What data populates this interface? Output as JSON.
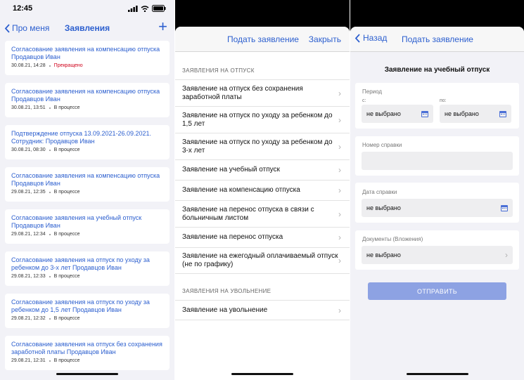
{
  "panel1": {
    "status_time": "12:45",
    "back_label": "Про меня",
    "title": "Заявления",
    "add_label": "+",
    "items": [
      {
        "title": "Согласование заявления на компенсацию отпуска Продавцов Иван",
        "date": "30.08.21, 14:28",
        "status": "Прекращено",
        "red": true
      },
      {
        "title": "Согласование заявления на компенсацию отпуска Продавцов Иван",
        "date": "30.08.21, 13:51",
        "status": "В процессе"
      },
      {
        "title": "Подтверждение отпуска 13.09.2021-26.09.2021. Сотрудник: Продавцов Иван",
        "date": "30.08.21, 08:30",
        "status": "В процессе"
      },
      {
        "title": "Согласование заявления на компенсацию отпуска Продавцов Иван",
        "date": "29.08.21, 12:35",
        "status": "В процессе"
      },
      {
        "title": "Согласование заявления на учебный отпуск Продавцов Иван",
        "date": "29.08.21, 12:34",
        "status": "В процессе"
      },
      {
        "title": "Согласование заявления на отпуск по уходу за ребенком до 3-х лет Продавцов Иван",
        "date": "29.08.21, 12:33",
        "status": "В процессе"
      },
      {
        "title": "Согласование заявления на отпуск по уходу за ребенком до 1,5 лет Продавцов Иван",
        "date": "29.08.21, 12:32",
        "status": "В процессе"
      },
      {
        "title": "Согласование заявления на отпуск без сохранения заработной платы Продавцов Иван",
        "date": "29.08.21, 12:31",
        "status": "В процессе"
      }
    ]
  },
  "panel2": {
    "header_title": "Подать заявление",
    "close_label": "Закрыть",
    "section1_label": "ЗАЯВЛЕНИЯ НА ОТПУСК",
    "section1_items": [
      "Заявление на отпуск без сохранения заработной платы",
      "Заявление на отпуск по уходу за ребенком до 1,5 лет",
      "Заявление на отпуск по уходу за ребенком до 3-х лет",
      "Заявление на учебный отпуск",
      "Заявление на компенсацию отпуска",
      "Заявление на перенос отпуска в связи с больничным листом",
      "Заявление на перенос отпуска",
      "Заявление на ежегодный оплачиваемый отпуск (не по графику)"
    ],
    "section2_label": "ЗАЯВЛЕНИЯ НА УВОЛЬНЕНИЕ",
    "section2_items": [
      "Заявление на увольнение"
    ]
  },
  "panel3": {
    "back_label": "Назад",
    "header_title": "Подать заявление",
    "form_title": "Заявление на учебный отпуск",
    "period_label": "Период",
    "from_label": "с:",
    "to_label": "по:",
    "from_value": "не выбрано",
    "to_value": "не выбрано",
    "cert_number_label": "Номер справки",
    "cert_number_value": "",
    "cert_date_label": "Дата справки",
    "cert_date_value": "не выбрано",
    "docs_label": "Документы (Вложения)",
    "docs_value": "не выбрано",
    "submit_label": "ОТПРАВИТЬ"
  },
  "colors": {
    "accent": "#2c5fcf",
    "danger": "#d0021b",
    "submit": "#8da2e3"
  }
}
